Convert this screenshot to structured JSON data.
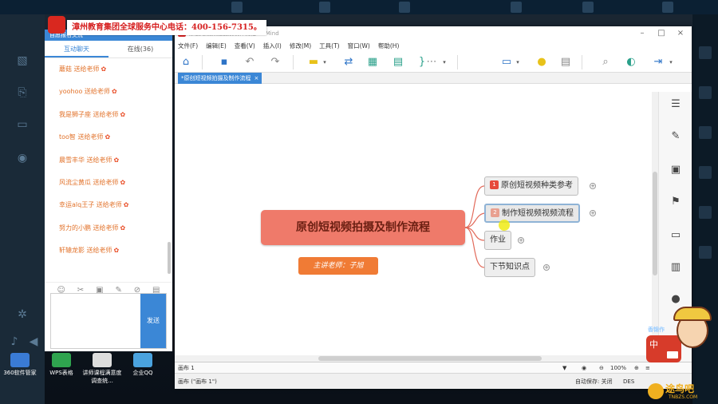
{
  "banner": {
    "text": "漳州教育集团全球服务中心电话：400-156-7315。"
  },
  "chat": {
    "title": "自愿报名交流",
    "tabs": [
      {
        "label": "互动聊天"
      },
      {
        "label": "在线(36)"
      }
    ],
    "messages": [
      {
        "text": "蘑菇 送给老师"
      },
      {
        "text": "yoohoo 送给老师"
      },
      {
        "text": "我是狮子座 送给老师"
      },
      {
        "text": "too智 送给老师"
      },
      {
        "text": "晨雪丰华 送给老师"
      },
      {
        "text": "风流尘黄瓜 送给老师"
      },
      {
        "text": "幸运alq王子 送给老师"
      },
      {
        "text": "努力的小鹏 送给老师"
      },
      {
        "text": "轩辕龙影 送给老师"
      }
    ],
    "send_label": "发送"
  },
  "desktop_icons": [
    {
      "label": "360软件管家"
    },
    {
      "label": "WPS表格"
    },
    {
      "label": "讲师课程满意度调查统..."
    },
    {
      "label": "企业QQ"
    }
  ],
  "xmind": {
    "window_title": "原创短视频拍摄及制作流程 - XMind",
    "menu": [
      "文件(F)",
      "编辑(E)",
      "查看(V)",
      "插入(I)",
      "修改(M)",
      "工具(T)",
      "窗口(W)",
      "帮助(H)"
    ],
    "doc_tab": "*原创短视频拍摄及制作流程",
    "map": {
      "central": "原创短视频拍摄及制作流程",
      "presenter": "主讲老师：子旭",
      "topics": [
        {
          "num": "1",
          "text": "原创短视频种类参考"
        },
        {
          "num": "2",
          "text": "制作短视频视频流程"
        },
        {
          "num": "",
          "text": "作业"
        },
        {
          "num": "",
          "text": "下节知识点"
        }
      ]
    },
    "sheet_tab": "画布 1",
    "zoom": "100%",
    "status_left": "画布 (\"画布 1\")",
    "autosave": "自动保存: 关闭",
    "status_right": "DES"
  },
  "mascot": {
    "label": "中",
    "tag": "香锦作"
  },
  "watermark": {
    "name": "途鸟吧",
    "domain": "TNBZS.COM"
  },
  "colors": {
    "central_topic": "#ef7a6a",
    "presenter_box": "#f07b35",
    "accent_blue": "#3b87d6",
    "banner_text": "#d62020"
  }
}
